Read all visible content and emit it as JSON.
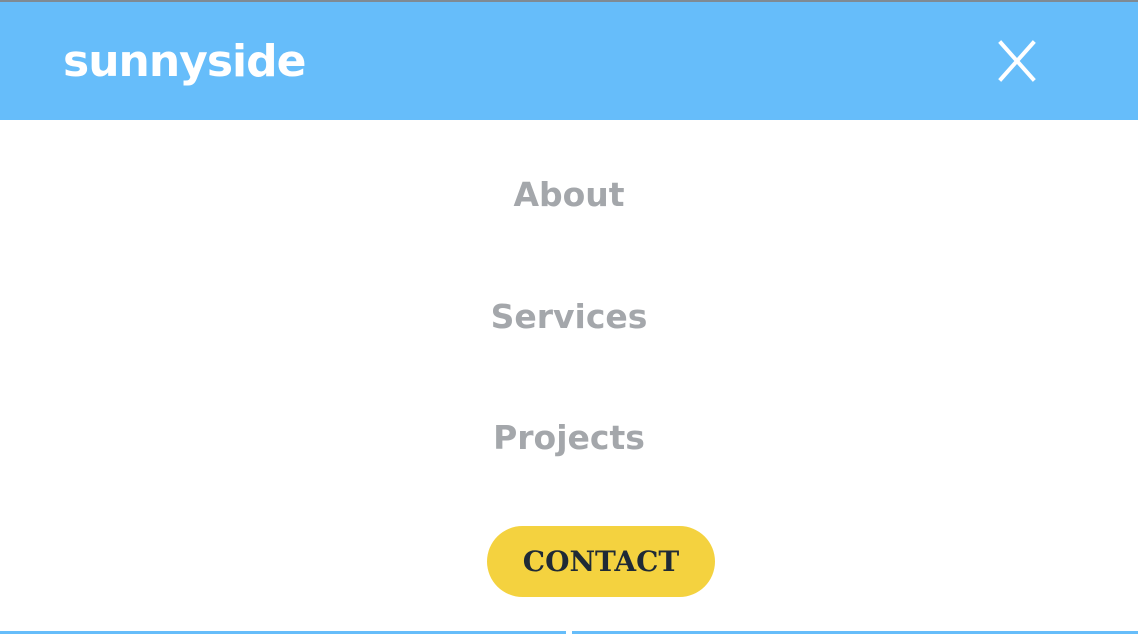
{
  "header": {
    "logo_text": "sunnyside",
    "close_icon": "close-icon"
  },
  "menu": {
    "items": [
      {
        "label": "About"
      },
      {
        "label": "Services"
      },
      {
        "label": "Projects"
      }
    ],
    "contact_label": "CONTACT"
  },
  "colors": {
    "header_bg": "#66bdfa",
    "menu_text": "#a4a7ab",
    "contact_bg": "#f4d23f",
    "contact_text": "#1f2a36"
  }
}
